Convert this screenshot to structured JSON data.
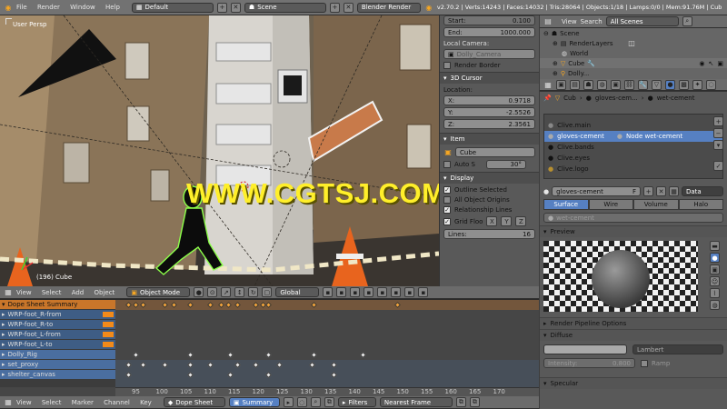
{
  "info_header": {
    "menu": [
      "File",
      "Render",
      "Window",
      "Help"
    ],
    "layout": "Default",
    "scene": "Scene",
    "engine": "Blender Render",
    "stats": "v2.70.2 | Verts:14243 | Faces:14032 | Tris:28064 | Objects:1/18 | Lamps:0/0 | Mem:91.76M | Cub"
  },
  "viewport": {
    "view_label": "User Persp",
    "frame_label": "(196) Cube",
    "watermark": "WWW.CGTSJ.COM",
    "header": {
      "menu": [
        "View",
        "Select",
        "Add",
        "Object"
      ],
      "mode": "Object Mode",
      "orientation": "Global"
    }
  },
  "npanel": {
    "start_label": "Start:",
    "start_value": "0.100",
    "end_label": "End:",
    "end_value": "1000.000",
    "local_camera_label": "Local Camera:",
    "local_camera_value": "Dolly_Camera",
    "render_border": "Render Border",
    "cursor_title": "3D Cursor",
    "location_label": "Location:",
    "x_label": "X:",
    "x_value": "0.9718",
    "y_label": "Y:",
    "y_value": "-2.5526",
    "z_label": "Z:",
    "z_value": "2.3561",
    "item_title": "Item",
    "item_name": "Cube",
    "auto_label": "Auto S",
    "auto_value": "30°",
    "display_label": "Display",
    "outline_selected": "Outline Selected",
    "all_origins": "All Object Origins",
    "relationship_lines": "Relationship Lines",
    "grid_floor": "Grid Floo",
    "axes": [
      "X",
      "Y",
      "Z"
    ],
    "lines_label": "Lines:",
    "lines_value": "16"
  },
  "outliner": {
    "header": {
      "view": "View",
      "search": "Search",
      "filter": "All Scenes"
    },
    "rows": [
      "Scene",
      "RenderLayers",
      "World",
      "Cube",
      "Dolly..."
    ]
  },
  "properties": {
    "breadcrumb": [
      "Cub",
      "gloves-cem...",
      "wet-cement"
    ],
    "material_slots": [
      "Clive.main",
      "gloves-cement",
      "Clive.bands",
      "Clive.eyes",
      "Clive.logo"
    ],
    "node_label": "Node wet-cement",
    "material_name": "gloves-cement",
    "fake_user": "F",
    "data_dropdown": "Data",
    "tabs": [
      "Surface",
      "Wire",
      "Volume",
      "Halo"
    ],
    "node_material": "wet-cement",
    "preview_title": "Preview",
    "render_pipeline": "Render Pipeline Options",
    "diffuse_title": "Diffuse",
    "diffuse_shader": "Lambert",
    "intensity_label": "Intensity:",
    "intensity_value": "0.800",
    "ramp_label": "Ramp",
    "specular_title": "Specular"
  },
  "dopesheet": {
    "channels": [
      {
        "name": "Dope Sheet Summary",
        "kind": "summary"
      },
      {
        "name": "WRP-foot_R-from",
        "kind": "grp"
      },
      {
        "name": "WRP-foot_R-to",
        "kind": "grp"
      },
      {
        "name": "WRP-foot_L-from",
        "kind": "grp"
      },
      {
        "name": "WRP-foot_L-to",
        "kind": "grp"
      },
      {
        "name": "Dolly_Rig",
        "kind": "obj"
      },
      {
        "name": "set_proxy",
        "kind": "obj"
      },
      {
        "name": "shelter_canvas",
        "kind": "obj"
      }
    ],
    "ruler": [
      "95",
      "100",
      "105",
      "110",
      "115",
      "120",
      "125",
      "130",
      "135",
      "140",
      "145",
      "150",
      "155",
      "160",
      "165",
      "170"
    ],
    "header": {
      "menu": [
        "View",
        "Select",
        "Marker",
        "Channel",
        "Key"
      ],
      "mode": "Dope Sheet",
      "summary": "Summary",
      "filters": "Filters",
      "snap": "Nearest Frame"
    }
  },
  "colors": {
    "accent": "#5680c2",
    "summary": "#c9762a",
    "watermark": "#ffef2a"
  }
}
